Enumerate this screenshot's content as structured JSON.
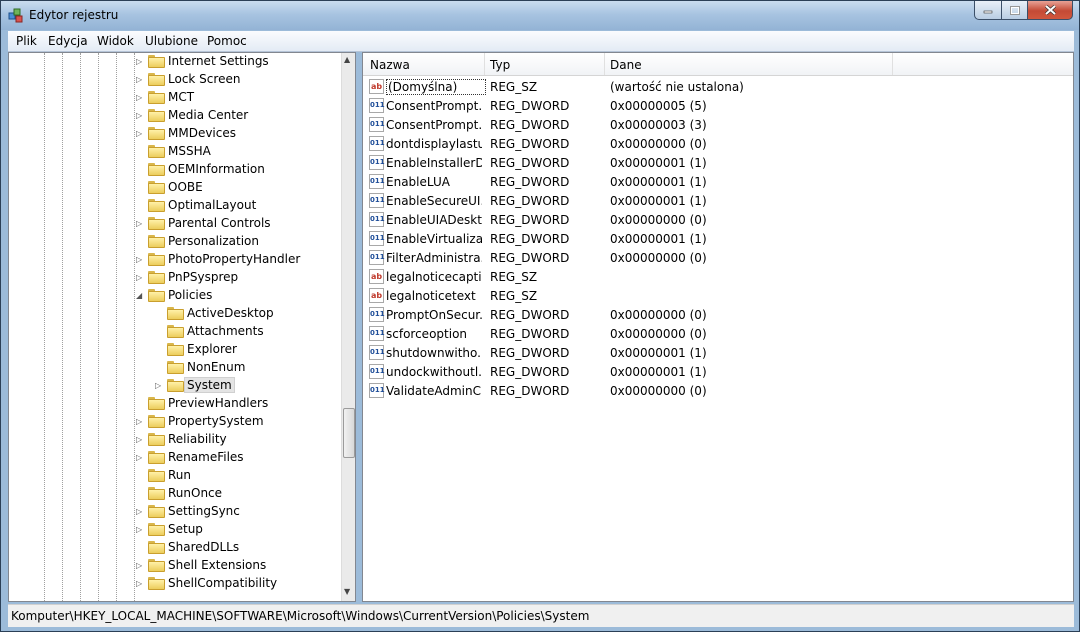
{
  "window": {
    "title": "Edytor rejestru"
  },
  "menu": [
    {
      "label": "Plik"
    },
    {
      "label": "Edycja"
    },
    {
      "label": "Widok"
    },
    {
      "label": "Ulubione"
    },
    {
      "label": "Pomoc"
    }
  ],
  "tree": [
    {
      "label": "Internet Settings",
      "expander": "collapsed"
    },
    {
      "label": "Lock Screen",
      "expander": "collapsed"
    },
    {
      "label": "MCT",
      "expander": "collapsed"
    },
    {
      "label": "Media Center",
      "expander": "collapsed"
    },
    {
      "label": "MMDevices",
      "expander": "collapsed"
    },
    {
      "label": "MSSHA",
      "expander": "none"
    },
    {
      "label": "OEMInformation",
      "expander": "none"
    },
    {
      "label": "OOBE",
      "expander": "none"
    },
    {
      "label": "OptimalLayout",
      "expander": "none"
    },
    {
      "label": "Parental Controls",
      "expander": "collapsed"
    },
    {
      "label": "Personalization",
      "expander": "none"
    },
    {
      "label": "PhotoPropertyHandler",
      "expander": "collapsed"
    },
    {
      "label": "PnPSysprep",
      "expander": "collapsed"
    },
    {
      "label": "Policies",
      "expander": "expanded"
    },
    {
      "label": "ActiveDesktop",
      "expander": "none",
      "child": true
    },
    {
      "label": "Attachments",
      "expander": "none",
      "child": true
    },
    {
      "label": "Explorer",
      "expander": "none",
      "child": true
    },
    {
      "label": "NonEnum",
      "expander": "none",
      "child": true
    },
    {
      "label": "System",
      "expander": "collapsed",
      "child": true,
      "selected": true
    },
    {
      "label": "PreviewHandlers",
      "expander": "none"
    },
    {
      "label": "PropertySystem",
      "expander": "collapsed"
    },
    {
      "label": "Reliability",
      "expander": "collapsed"
    },
    {
      "label": "RenameFiles",
      "expander": "collapsed"
    },
    {
      "label": "Run",
      "expander": "none"
    },
    {
      "label": "RunOnce",
      "expander": "none"
    },
    {
      "label": "SettingSync",
      "expander": "collapsed"
    },
    {
      "label": "Setup",
      "expander": "collapsed"
    },
    {
      "label": "SharedDLLs",
      "expander": "none"
    },
    {
      "label": "Shell Extensions",
      "expander": "collapsed"
    },
    {
      "label": "ShellCompatibility",
      "expander": "collapsed"
    }
  ],
  "columns": {
    "name": "Nazwa",
    "type": "Typ",
    "data": "Dane"
  },
  "values": [
    {
      "icon": "string-value-icon",
      "kind": "sz",
      "name": "(Domyślna)",
      "type": "REG_SZ",
      "data": "(wartość nie ustalona)",
      "selected": true
    },
    {
      "icon": "dword-value-icon",
      "kind": "dw",
      "name": "ConsentPrompt...",
      "type": "REG_DWORD",
      "data": "0x00000005 (5)"
    },
    {
      "icon": "dword-value-icon",
      "kind": "dw",
      "name": "ConsentPrompt...",
      "type": "REG_DWORD",
      "data": "0x00000003 (3)"
    },
    {
      "icon": "dword-value-icon",
      "kind": "dw",
      "name": "dontdisplaylastu...",
      "type": "REG_DWORD",
      "data": "0x00000000 (0)"
    },
    {
      "icon": "dword-value-icon",
      "kind": "dw",
      "name": "EnableInstallerD...",
      "type": "REG_DWORD",
      "data": "0x00000001 (1)"
    },
    {
      "icon": "dword-value-icon",
      "kind": "dw",
      "name": "EnableLUA",
      "type": "REG_DWORD",
      "data": "0x00000001 (1)"
    },
    {
      "icon": "dword-value-icon",
      "kind": "dw",
      "name": "EnableSecureUI...",
      "type": "REG_DWORD",
      "data": "0x00000001 (1)"
    },
    {
      "icon": "dword-value-icon",
      "kind": "dw",
      "name": "EnableUIADeskt...",
      "type": "REG_DWORD",
      "data": "0x00000000 (0)"
    },
    {
      "icon": "dword-value-icon",
      "kind": "dw",
      "name": "EnableVirtualizat...",
      "type": "REG_DWORD",
      "data": "0x00000001 (1)"
    },
    {
      "icon": "dword-value-icon",
      "kind": "dw",
      "name": "FilterAdministra...",
      "type": "REG_DWORD",
      "data": "0x00000000 (0)"
    },
    {
      "icon": "string-value-icon",
      "kind": "sz",
      "name": "legalnoticecapti...",
      "type": "REG_SZ",
      "data": ""
    },
    {
      "icon": "string-value-icon",
      "kind": "sz",
      "name": "legalnoticetext",
      "type": "REG_SZ",
      "data": ""
    },
    {
      "icon": "dword-value-icon",
      "kind": "dw",
      "name": "PromptOnSecur...",
      "type": "REG_DWORD",
      "data": "0x00000000 (0)"
    },
    {
      "icon": "dword-value-icon",
      "kind": "dw",
      "name": "scforceoption",
      "type": "REG_DWORD",
      "data": "0x00000000 (0)"
    },
    {
      "icon": "dword-value-icon",
      "kind": "dw",
      "name": "shutdownwitho...",
      "type": "REG_DWORD",
      "data": "0x00000001 (1)"
    },
    {
      "icon": "dword-value-icon",
      "kind": "dw",
      "name": "undockwithoutl...",
      "type": "REG_DWORD",
      "data": "0x00000001 (1)"
    },
    {
      "icon": "dword-value-icon",
      "kind": "dw",
      "name": "ValidateAdminC...",
      "type": "REG_DWORD",
      "data": "0x00000000 (0)"
    }
  ],
  "icon_labels": {
    "sz": "ab",
    "dw": "011"
  },
  "status": {
    "path": "Komputer\\HKEY_LOCAL_MACHINE\\SOFTWARE\\Microsoft\\Windows\\CurrentVersion\\Policies\\System"
  }
}
